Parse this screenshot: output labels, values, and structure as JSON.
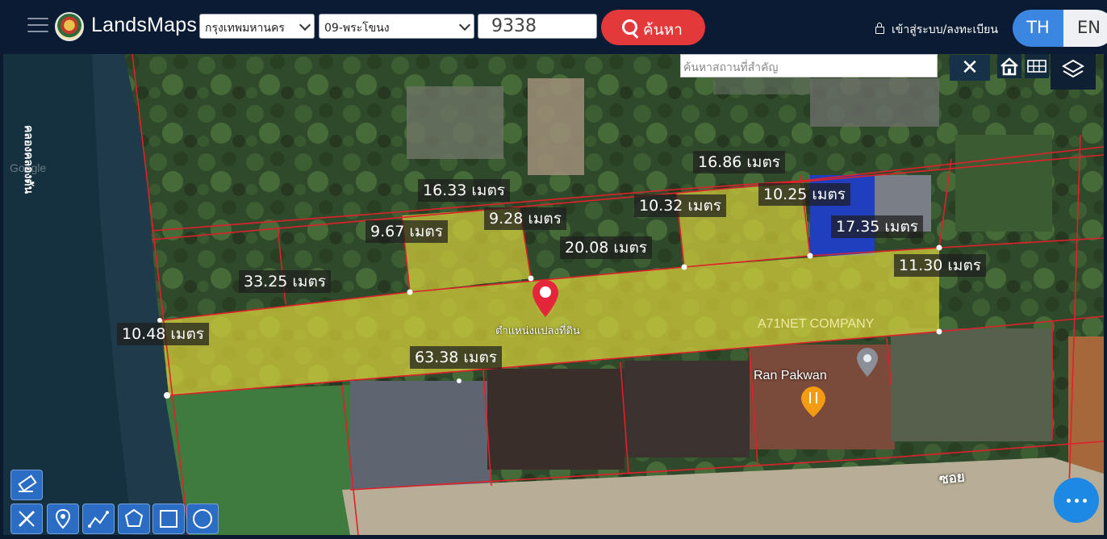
{
  "header": {
    "brand": "LandsMaps",
    "province_select": "กรุงเทพมหานคร",
    "district_select": "09-พระโขนง",
    "parcel_number": "9338",
    "search_label": "ค้นหา",
    "login_label": "เข้าสู่ระบบ/ลงทะเบียน",
    "lang_th": "TH",
    "lang_en": "EN"
  },
  "map": {
    "place_search_placeholder": "ค้นหาสถานที่สำคัญ",
    "close_symbol": "✕",
    "parcel_marker_label": "ตำแหน่งแปลงที่ดิน",
    "canal_label": "คลองคลองตัน",
    "street_label": "ซอย",
    "business_labels": [
      "A71NET COMPANY",
      "Ran Pakwan"
    ],
    "watermark": "Google",
    "measurements": {
      "m1": "16.86 เมตร",
      "m2": "16.33 เมตร",
      "m3": "10.32 เมตร",
      "m4": "10.25 เมตร",
      "m5": "9.28 เมตร",
      "m6": "17.35 เมตร",
      "m7": "9.67 เมตร",
      "m8": "20.08 เมตร",
      "m9": "11.30 เมตร",
      "m10": "33.25 เมตร",
      "m11": "10.48 เมตร",
      "m12": "63.38 เมตร"
    }
  },
  "colors": {
    "topbar": "#0b1b33",
    "search_button": "#e3393b",
    "lang_active": "#3a86e0",
    "parcel_fill": "#d9d23a",
    "boundary": "#e0202a",
    "tool_button": "#2b6dc4"
  },
  "icons": [
    "menu-icon",
    "search-icon",
    "lock-icon",
    "home-icon",
    "grid-icon",
    "layers-icon",
    "eraser-icon",
    "ruler-icon",
    "pin-icon",
    "polyline-icon",
    "polygon-icon",
    "rectangle-icon",
    "circle-icon",
    "more-icon",
    "location-pin-icon",
    "restaurant-icon",
    "place-icon"
  ]
}
